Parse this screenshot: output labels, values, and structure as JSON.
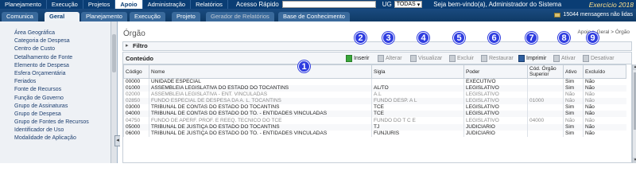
{
  "topnav": {
    "tabs": [
      "Planejamento",
      "Execução",
      "Projetos",
      "Apoio",
      "Administração",
      "Relatórios"
    ],
    "quick_search_label": "Acesso Rápido",
    "ug_label": "UG",
    "ug_value": "TODAS",
    "welcome": "Seja bem-vindo(a), Administrador do Sistema",
    "exercicio": "Exercício 2018"
  },
  "subnav": {
    "tabs": [
      "Comunica",
      "Geral",
      "Planejamento",
      "Execução",
      "Projeto",
      "Gerador de Relatórios",
      "Base de Conhecimento"
    ],
    "messages": "15044 mensagens não lidas"
  },
  "sidebar": {
    "items": [
      "Área Geográfica",
      "Categoria de Despesa",
      "Centro de Custo",
      "Detalhamento de Fonte",
      "Elemento de Despesa",
      "Esfera Orçamentária",
      "Feriados",
      "Fonte de Recursos",
      "Função de Governo",
      "Grupo de Assinaturas",
      "Grupo de Despesa",
      "Grupo de Fontes de Recursos",
      "Identificador de Uso",
      "Modalidade de Aplicação"
    ]
  },
  "main": {
    "title": "Órgão",
    "breadcrumb": [
      "Apoio",
      "Geral",
      "Órgão"
    ],
    "filter_label": "Filtro",
    "content_label": "Conteúdo",
    "toolbar": [
      "Inserir",
      "Alterar",
      "Visualizar",
      "Excluir",
      "Restaurar",
      "Imprimir",
      "Ativar",
      "Desativar"
    ],
    "badges": [
      "1",
      "2",
      "3",
      "4",
      "5",
      "6",
      "7",
      "8",
      "9"
    ],
    "columns": [
      "Código",
      "Nome",
      "Sigla",
      "Poder",
      "Cód. Órgão Superior",
      "Ativo",
      "Excluído"
    ],
    "rows": [
      [
        "00000",
        "UNIDADE ESPECIAL",
        "",
        "EXECUTIVO",
        "",
        "Sim",
        "Não"
      ],
      [
        "01000",
        "ASSEMBLEIA LEGISLATIVA DO ESTADO DO TOCANTINS",
        "AL/TO",
        "LEGISLATIVO",
        "",
        "Sim",
        "Não"
      ],
      [
        "02000",
        "ASSEMBLEIA LEGISLATIVA - ENT. VINCULADAS",
        "A.L",
        "LEGISLATIVO",
        "",
        "Não",
        "Não"
      ],
      [
        "02850",
        "FUNDO ESPECIAL DE DESPESA DA A. L. TOCANTINS",
        "FUNDO DESP. A L",
        "LEGISLATIVO",
        "01000",
        "Não",
        "Não"
      ],
      [
        "03000",
        "TRIBUNAL DE CONTAS DO ESTADO DO TOCANTINS",
        "TCE",
        "LEGISLATIVO",
        "",
        "Sim",
        "Não"
      ],
      [
        "04000",
        "TRIBUNAL DE CONTAS DO ESTADO DO TO. - ENTIDADES VINCULADAS",
        "TCE",
        "LEGISLATIVO",
        "",
        "Sim",
        "Não"
      ],
      [
        "04750",
        "FUNDO DE APERF. PROF. E REEQ. TECNICO DO TCE",
        "FUNDO DO T C E",
        "LEGISLATIVO",
        "04000",
        "Não",
        "Não"
      ],
      [
        "05000",
        "TRIBUNAL DE JUSTIÇA DO ESTADO DO TOCANTINS",
        "TJ",
        "JUDICIARIO",
        "",
        "Sim",
        "Não"
      ],
      [
        "06000",
        "TRIBUNAL DE JUSTIÇA DO ESTADO DO TO. - ENTIDADES VINCULADAS",
        "FUNJURIS",
        "JUDICIARIO",
        "",
        "Sim",
        "Não"
      ]
    ],
    "dim_rows": [
      2,
      3,
      6
    ]
  }
}
